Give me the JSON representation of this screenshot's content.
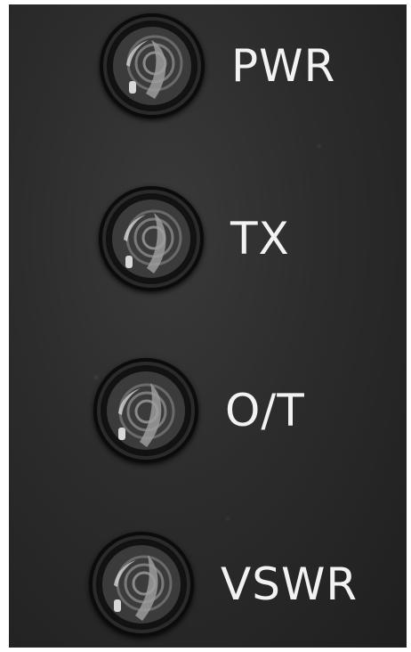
{
  "indicators": [
    {
      "label": "PWR",
      "icon": "led-lens-icon"
    },
    {
      "label": "TX",
      "icon": "led-lens-icon"
    },
    {
      "label": "O/T",
      "icon": "led-lens-icon"
    },
    {
      "label": "VSWR",
      "icon": "led-lens-icon"
    }
  ],
  "colors": {
    "panel": "#2c2c2c",
    "label": "#f2f2f2",
    "lens_rim": "#0b0b0b"
  }
}
